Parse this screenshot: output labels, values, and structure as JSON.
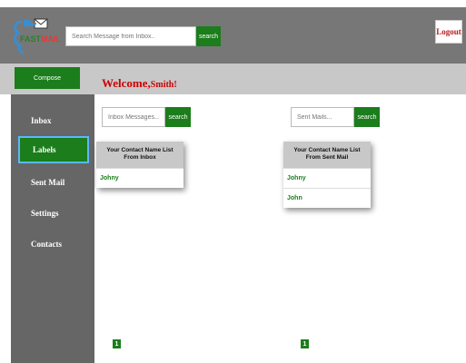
{
  "app": {
    "logo_word_fast": "FAST",
    "logo_word_mail": "MAIL"
  },
  "header": {
    "search_placeholder": "Search Message from Inbox..",
    "search_button": "search",
    "logout_label": "Logout"
  },
  "subbar": {
    "compose_label": "Compose",
    "welcome_text": "Welcome,",
    "welcome_name": "Smith!"
  },
  "sidebar": {
    "items": [
      {
        "label": "Inbox"
      },
      {
        "label": "Labels"
      },
      {
        "label": "Sent Mail"
      },
      {
        "label": "Settings"
      },
      {
        "label": "Contacts"
      }
    ]
  },
  "inbox_panel": {
    "search_placeholder": "Inbox Messages...",
    "search_button": "search",
    "card_title": "Your Contact Name List From Inbox",
    "contacts": [
      "Johny"
    ],
    "page": "1"
  },
  "sent_panel": {
    "search_placeholder": "Sent Mails...",
    "search_button": "search",
    "card_title": "Your Contact Name List From Sent Mail",
    "contacts": [
      "Johny",
      "John"
    ],
    "page": "1"
  },
  "colors": {
    "accent_green": "#1b7d1b",
    "welcome_red": "#cc0000",
    "header_gray": "#777777"
  }
}
